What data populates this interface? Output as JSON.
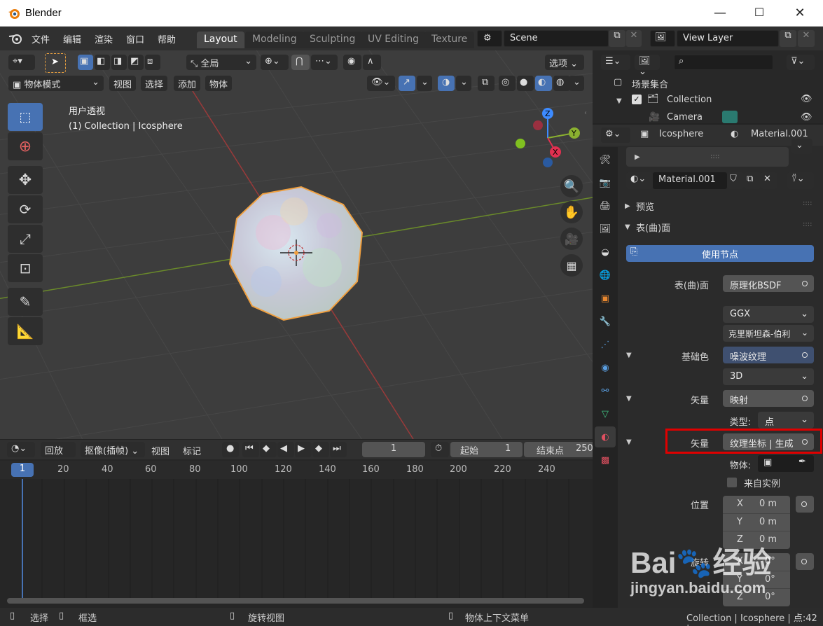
{
  "window": {
    "title": "Blender"
  },
  "menu": [
    "文件",
    "编辑",
    "渲染",
    "窗口",
    "帮助"
  ],
  "workspaces": [
    "Layout",
    "Modeling",
    "Sculpting",
    "UV Editing",
    "Texture"
  ],
  "scene": {
    "label": "Scene"
  },
  "view_layer": {
    "label": "View Layer"
  },
  "viewport": {
    "global_label": "全局",
    "options_label": "选项",
    "mode_label": "物体模式",
    "menu": [
      "视图",
      "选择",
      "添加",
      "物体"
    ],
    "view_name": "用户透视",
    "collection_info": "(1) Collection | Icosphere",
    "gizmo": {
      "z": "Z",
      "y": "Y",
      "x": "X"
    }
  },
  "timeline": {
    "playback": "回放",
    "keying": "抠像(插帧)",
    "view": "视图",
    "marker": "标记",
    "current_frame": "1",
    "start_label": "起始",
    "start_value": "1",
    "end_label": "结束点",
    "end_value": "250",
    "ruler": [
      "1",
      "20",
      "40",
      "60",
      "80",
      "100",
      "120",
      "140",
      "160",
      "180",
      "200",
      "220",
      "240"
    ]
  },
  "outliner": {
    "scene_collection": "场景集合",
    "items": [
      "Collection",
      "Camera"
    ]
  },
  "properties": {
    "object_name": "Icosphere",
    "material_name": "Material.001",
    "material_slot": "Material.001",
    "slot_dots": "::::",
    "preview": "预览",
    "surface": "表(曲)面",
    "use_nodes": "使用节点",
    "rows": [
      {
        "label": "表(曲)面",
        "value": "原理化BSDF"
      },
      {
        "label": "",
        "value": "GGX"
      },
      {
        "label": "",
        "value": "克里斯坦森-伯利"
      },
      {
        "label": "基础色",
        "value": "噪波纹理"
      },
      {
        "label": "",
        "value": "3D"
      },
      {
        "label": "矢量",
        "value": "映射"
      },
      {
        "label": "类型:",
        "value": "点"
      },
      {
        "label": "矢量",
        "value": "纹理坐标 | 生成"
      },
      {
        "label": "物体:",
        "value": ""
      }
    ],
    "from_instance": "来自实例",
    "location_label": "位置",
    "location": [
      {
        "axis": "X",
        "value": "0 m"
      },
      {
        "axis": "Y",
        "value": "0 m"
      },
      {
        "axis": "Z",
        "value": "0 m"
      }
    ],
    "rotation_label": "旋转",
    "rotation": [
      {
        "axis": "X",
        "value": "0°"
      },
      {
        "axis": "Y",
        "value": "0°"
      },
      {
        "axis": "Z",
        "value": "0°"
      }
    ]
  },
  "statusbar": {
    "select": "选择",
    "box_select": "框选",
    "rotate_view": "旋转视图",
    "context_menu": "物体上下文菜单",
    "info": "Collection | Icosphere | 点:42 |"
  },
  "watermark": "Baidu经验 jingyan.baidu.com",
  "colors": {
    "accent": "#4772b3",
    "highlight_box": "#e00000",
    "selection_outline": "#f0a040"
  }
}
